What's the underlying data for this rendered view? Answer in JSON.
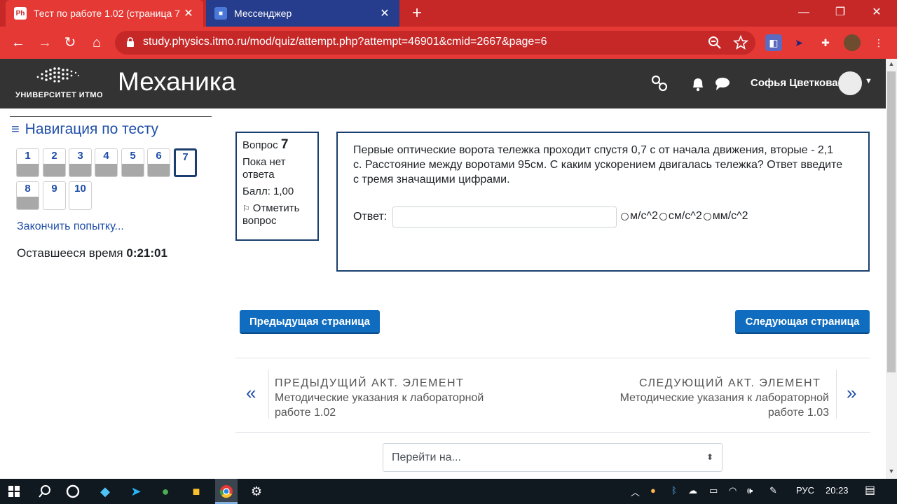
{
  "browser": {
    "tabs": [
      {
        "favicon": "Ph",
        "title": "Тест по работе 1.02 (страница 7",
        "close": "✕"
      },
      {
        "favicon": "■",
        "title": "Мессенджер",
        "close": "✕"
      }
    ],
    "new_tab": "+",
    "window_controls": [
      "—",
      "❐",
      "✕"
    ],
    "url": "study.physics.itmo.ru/mod/quiz/attempt.php?attempt=46901&cmid=2667&page=6",
    "nav_icons": [
      "←",
      "→",
      "↻",
      "⌂"
    ]
  },
  "header": {
    "logo_text": "УНИВЕРСИТЕТ ИТМО",
    "course_title": "Механика",
    "user_name": "Софья Цветкова"
  },
  "quiz_nav": {
    "title": "Навигация по тесту",
    "questions": [
      {
        "label": "1",
        "answered": true,
        "current": false
      },
      {
        "label": "2",
        "answered": true,
        "current": false
      },
      {
        "label": "3",
        "answered": true,
        "current": false
      },
      {
        "label": "4",
        "answered": true,
        "current": false
      },
      {
        "label": "5",
        "answered": true,
        "current": false
      },
      {
        "label": "6",
        "answered": true,
        "current": false
      },
      {
        "label": "7",
        "answered": false,
        "current": true
      },
      {
        "label": "8",
        "answered": true,
        "current": false
      },
      {
        "label": "9",
        "answered": false,
        "current": false
      },
      {
        "label": "10",
        "answered": false,
        "current": false
      }
    ],
    "finish_link": "Закончить попытку...",
    "time_label": "Оставшееся время",
    "time_value": "0:21:01"
  },
  "question": {
    "label": "Вопрос",
    "number": "7",
    "status": "Пока нет ответа",
    "mark": "Балл: 1,00",
    "flag": "Отметить вопрос",
    "text": "Первые  оптические ворота тележка проходит спустя 0,7 с от начала движения, вторые - 2,1 с. Расстояние между воротами 95см. С каким ускорением двигалась тележка? Ответ введите с тремя значащими цифрами.",
    "answer_label": "Ответ:",
    "answer_value": "",
    "units": [
      "м/с^2",
      "см/с^2",
      "мм/с^2"
    ]
  },
  "buttons": {
    "prev_page": "Предыдущая страница",
    "next_page": "Следующая страница"
  },
  "activity_nav": {
    "prev_heading": "ПРЕДЫДУЩИЙ АКТ. ЭЛЕМЕНТ",
    "prev_link": "Методические указания к лабораторной работе 1.02",
    "next_heading": "СЛЕДУЮЩИЙ АКТ. ЭЛЕМЕНТ",
    "next_link": "Методические указания к лабораторной работе 1.03",
    "jump_to": "Перейти на..."
  },
  "taskbar": {
    "language": "РУС",
    "time": "20:23"
  }
}
